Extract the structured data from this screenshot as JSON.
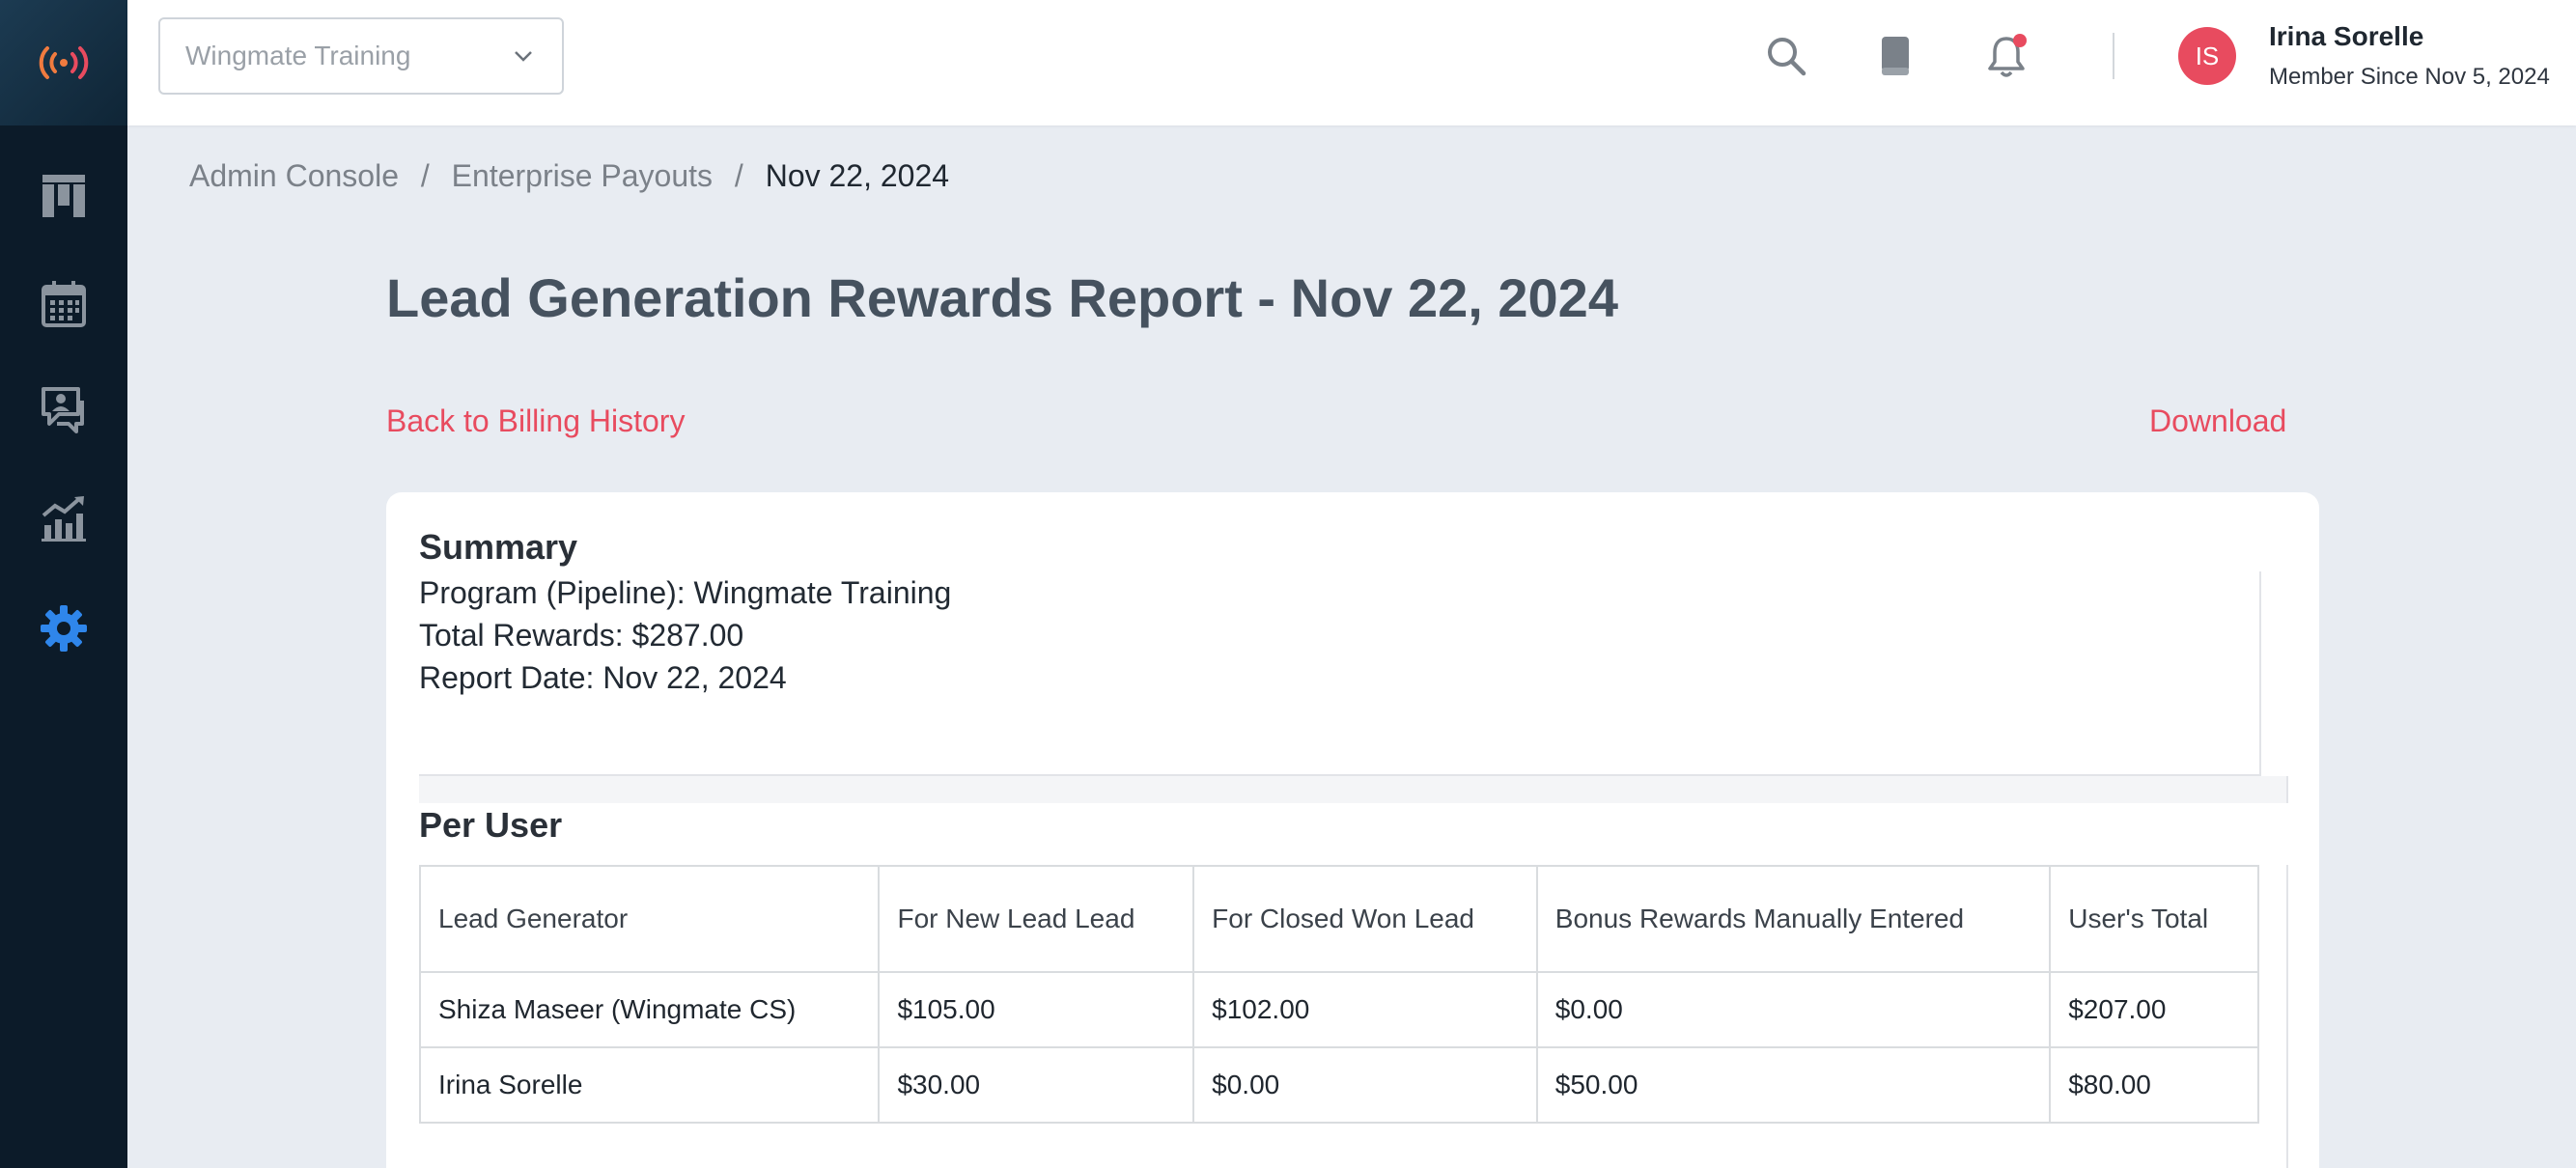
{
  "sidebar": {
    "logo_icon": "broadcast-signal-icon",
    "items": [
      {
        "name": "board",
        "icon": "kanban-board-icon"
      },
      {
        "name": "calendar",
        "icon": "calendar-icon"
      },
      {
        "name": "chat",
        "icon": "chat-person-icon"
      },
      {
        "name": "analytics",
        "icon": "chart-trend-icon"
      },
      {
        "name": "settings",
        "icon": "gear-icon",
        "active": true
      }
    ],
    "accent_color": "#2f86eb"
  },
  "topbar": {
    "program_select": "Wingmate Training",
    "user": {
      "initials": "IS",
      "name": "Irina Sorelle",
      "since": "Member Since Nov 5, 2024"
    },
    "icons": [
      "search-icon",
      "book-icon",
      "bell-icon"
    ]
  },
  "breadcrumb": [
    "Admin Console",
    "Enterprise Payouts",
    "Nov 22, 2024"
  ],
  "page": {
    "title": "Lead Generation Rewards Report - Nov 22, 2024",
    "back_link": "Back to Billing History",
    "download_link": "Download"
  },
  "summary": {
    "title": "Summary",
    "lines": [
      "Program (Pipeline): Wingmate Training",
      "Total Rewards: $287.00",
      "Report Date: Nov 22, 2024"
    ]
  },
  "per_user": {
    "title": "Per User",
    "columns": [
      "Lead Generator",
      "For New Lead Lead",
      "For Closed Won Lead",
      "Bonus Rewards Manually Entered",
      "User's Total"
    ],
    "rows": [
      [
        "Shiza Maseer (Wingmate CS)",
        "$105.00",
        "$102.00",
        "$0.00",
        "$207.00"
      ],
      [
        "Irina Sorelle",
        "$30.00",
        "$0.00",
        "$50.00",
        "$80.00"
      ]
    ]
  },
  "colors": {
    "brand_red": "#e84b5f",
    "sidebar_bg": "#0c1b29",
    "page_bg": "#e8ecf2"
  }
}
